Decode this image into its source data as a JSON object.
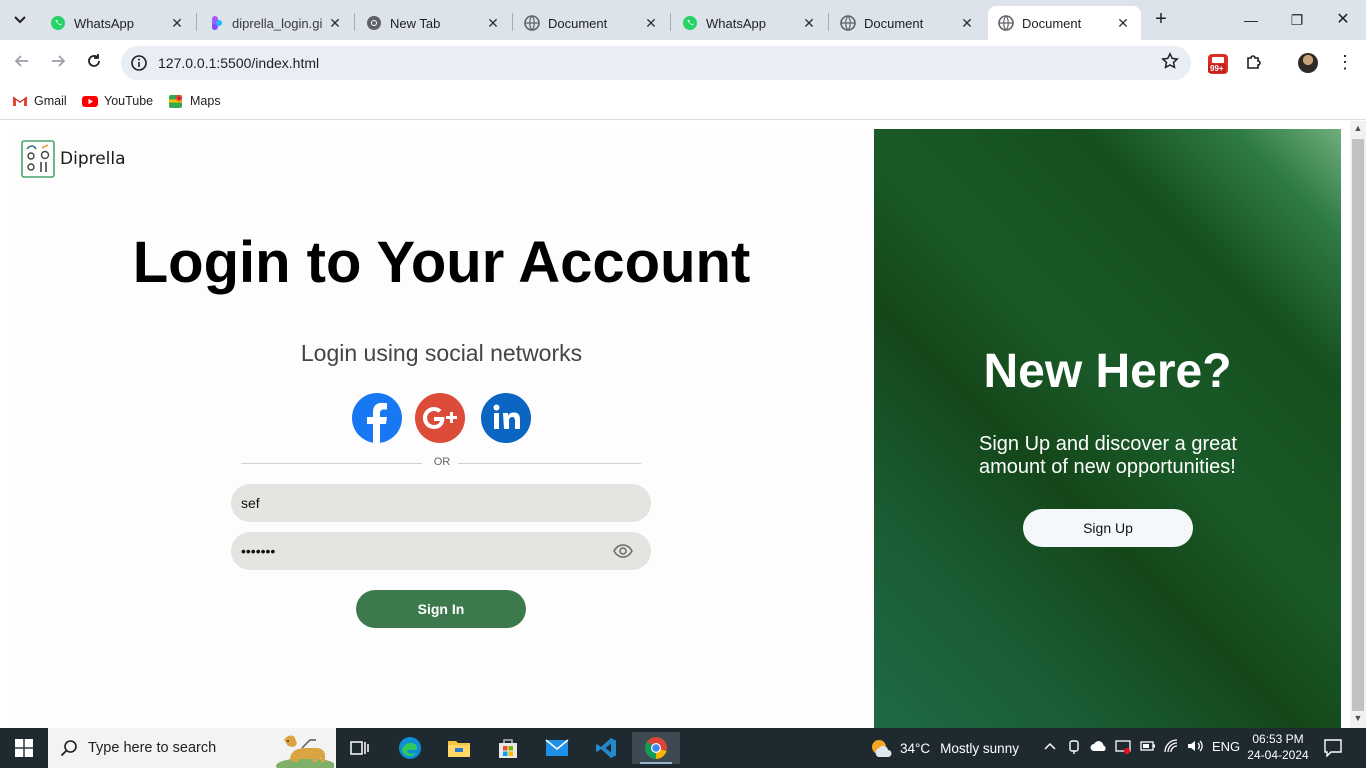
{
  "browser": {
    "tabs": [
      {
        "title": "WhatsApp",
        "icon": "whatsapp-icon",
        "active": false
      },
      {
        "title": "diprella_login.gi",
        "icon": "figma-icon",
        "active": false
      },
      {
        "title": "New Tab",
        "icon": "chrome-icon",
        "active": false
      },
      {
        "title": "Document",
        "icon": "globe-icon",
        "active": false
      },
      {
        "title": "WhatsApp",
        "icon": "whatsapp-icon",
        "active": false
      },
      {
        "title": "Document",
        "icon": "globe-icon",
        "active": false
      },
      {
        "title": "Document",
        "icon": "globe-icon",
        "active": true
      }
    ],
    "close_glyph": "✕",
    "new_tab_glyph": "+",
    "window_controls": {
      "minimize": "—",
      "restore": "❐",
      "close": "✕"
    },
    "url": "127.0.0.1:5500/index.html",
    "extension_badge": "99+",
    "bookmarks": [
      {
        "label": "Gmail",
        "icon": "gmail-icon"
      },
      {
        "label": "YouTube",
        "icon": "youtube-icon"
      },
      {
        "label": "Maps",
        "icon": "maps-icon"
      }
    ]
  },
  "page": {
    "logo_text": "Diprella",
    "login_title": "Login to Your Account",
    "social_heading": "Login using social networks",
    "or_text": "OR",
    "email_value": "sef",
    "password_value": "•••••••",
    "signin_label": "Sign In",
    "new_here_title": "New Here?",
    "new_here_text": "Sign Up and discover a great amount of new opportunities!",
    "signup_label": "Sign Up"
  },
  "taskbar": {
    "search_placeholder": "Type here to search",
    "weather_temp": "34°C",
    "weather_text": "Mostly sunny",
    "language": "ENG",
    "time": "06:53 PM",
    "date": "24-04-2024"
  },
  "colors": {
    "accent_green": "#3c7a4e",
    "panel_green": "#154f1f",
    "facebook": "#1877f2",
    "google_plus": "#dd4b39",
    "linkedin": "#0a66c2"
  }
}
